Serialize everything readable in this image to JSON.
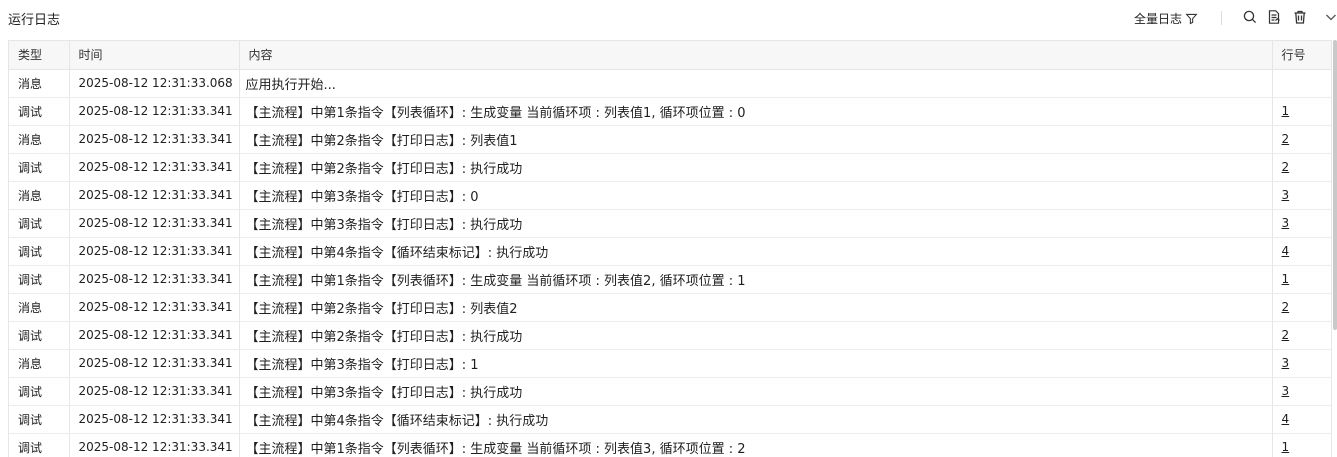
{
  "panel": {
    "title": "运行日志",
    "filter_label": "全量日志"
  },
  "icons": {
    "filter": "filter-icon",
    "search": "search-icon",
    "export": "export-icon",
    "delete": "trash-icon",
    "collapse": "chevron-down-icon"
  },
  "table": {
    "columns": [
      "类型",
      "时间",
      "内容",
      "行号"
    ],
    "rows": [
      {
        "type": "消息",
        "time": "2025-08-12 12:31:33.068",
        "content": "应用执行开始...",
        "line": ""
      },
      {
        "type": "调试",
        "time": "2025-08-12 12:31:33.341",
        "content": "【主流程】中第1条指令【列表循环】: 生成变量 当前循环项 : 列表值1, 循环项位置 : 0",
        "line": "1"
      },
      {
        "type": "消息",
        "time": "2025-08-12 12:31:33.341",
        "content": "【主流程】中第2条指令【打印日志】: 列表值1",
        "line": "2"
      },
      {
        "type": "调试",
        "time": "2025-08-12 12:31:33.341",
        "content": "【主流程】中第2条指令【打印日志】: 执行成功",
        "line": "2"
      },
      {
        "type": "消息",
        "time": "2025-08-12 12:31:33.341",
        "content": "【主流程】中第3条指令【打印日志】: 0",
        "line": "3"
      },
      {
        "type": "调试",
        "time": "2025-08-12 12:31:33.341",
        "content": "【主流程】中第3条指令【打印日志】: 执行成功",
        "line": "3"
      },
      {
        "type": "调试",
        "time": "2025-08-12 12:31:33.341",
        "content": "【主流程】中第4条指令【循环结束标记】: 执行成功",
        "line": "4"
      },
      {
        "type": "调试",
        "time": "2025-08-12 12:31:33.341",
        "content": "【主流程】中第1条指令【列表循环】: 生成变量 当前循环项 : 列表值2, 循环项位置 : 1",
        "line": "1"
      },
      {
        "type": "消息",
        "time": "2025-08-12 12:31:33.341",
        "content": "【主流程】中第2条指令【打印日志】: 列表值2",
        "line": "2"
      },
      {
        "type": "调试",
        "time": "2025-08-12 12:31:33.341",
        "content": "【主流程】中第2条指令【打印日志】: 执行成功",
        "line": "2"
      },
      {
        "type": "消息",
        "time": "2025-08-12 12:31:33.341",
        "content": "【主流程】中第3条指令【打印日志】: 1",
        "line": "3"
      },
      {
        "type": "调试",
        "time": "2025-08-12 12:31:33.341",
        "content": "【主流程】中第3条指令【打印日志】: 执行成功",
        "line": "3"
      },
      {
        "type": "调试",
        "time": "2025-08-12 12:31:33.341",
        "content": "【主流程】中第4条指令【循环结束标记】: 执行成功",
        "line": "4"
      },
      {
        "type": "调试",
        "time": "2025-08-12 12:31:33.341",
        "content": "【主流程】中第1条指令【列表循环】: 生成变量 当前循环项 : 列表值3, 循环项位置 : 2",
        "line": "1"
      }
    ]
  }
}
